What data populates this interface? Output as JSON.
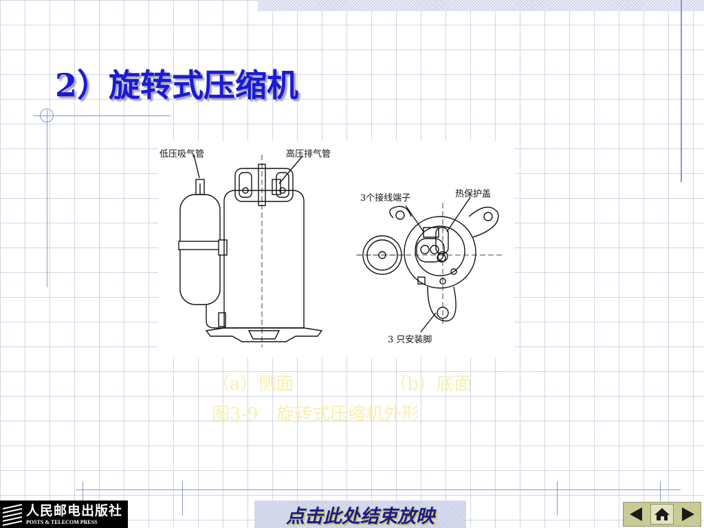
{
  "slide": {
    "title": "2）旋转式压缩机"
  },
  "figure": {
    "labels": {
      "low_pressure_suction": "低压吸气管",
      "high_pressure_discharge": "高压排气管",
      "terminals": "3个接线端子",
      "thermal_cover": "热保护盖",
      "mount_feet": "3 只安装脚"
    },
    "caption_a": "（a）侧面",
    "caption_b": "（b）底面",
    "caption_title": "图3-9　旋转式压缩机外形"
  },
  "footer": {
    "publisher_cn": "人民邮电出版社",
    "publisher_en": "POSTS & TELECOM PRESS",
    "end_show_label": "点击此处结束放映"
  },
  "nav": {
    "prev_icon": "triangle-left-icon",
    "home_icon": "home-icon",
    "next_icon": "triangle-right-icon"
  },
  "colors": {
    "title": "#1a1ad6",
    "caption": "#f6f0b0",
    "grid": "#96a5c8",
    "nav_bg": "#c8cc94"
  }
}
